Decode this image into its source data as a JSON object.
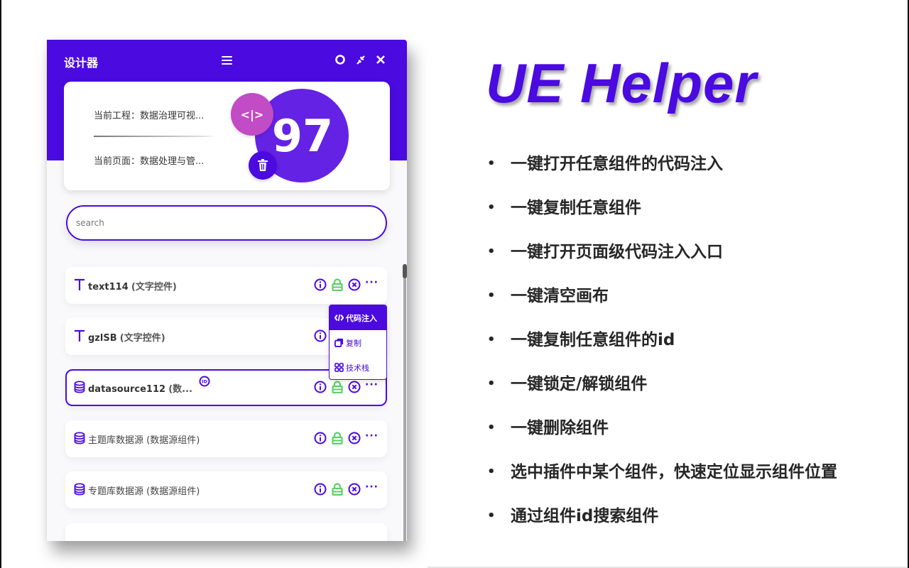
{
  "panel": {
    "title": "设计器",
    "header_icons": [
      "menu-icon",
      "refresh-icon",
      "collapse-icon",
      "close-icon"
    ],
    "project_line": "当前工程：数据治理可视...",
    "page_line": "当前页面：数据处理与管...",
    "component_count": "97",
    "code_button_glyph": "<|>",
    "search": {
      "placeholder": "search",
      "value": ""
    },
    "popover": {
      "items": [
        {
          "label": "代码注入",
          "icon": "code-icon"
        },
        {
          "label": "复制",
          "icon": "copy-icon"
        },
        {
          "label": "技术栈",
          "icon": "grid-icon"
        }
      ]
    },
    "components": [
      {
        "name": "text114",
        "type": "(文字控件)",
        "icon": "text-icon"
      },
      {
        "name": "gzlSB",
        "type": "(文字控件)",
        "icon": "text-icon"
      },
      {
        "name": "datasource112",
        "type": "(数...",
        "icon": "database-icon",
        "selected": true
      },
      {
        "name": "主题库数据源",
        "type": "(数据源组件)",
        "icon": "database-icon"
      },
      {
        "name": "专题库数据源",
        "type": "(数据源组件)",
        "icon": "database-icon"
      }
    ],
    "more_glyph": "···"
  },
  "brand": {
    "title": "UE Helper"
  },
  "features": [
    "一键打开任意组件的代码注入",
    "一键复制任意组件",
    "一键打开页面级代码注入入口",
    "一键清空画布",
    "一键复制任意组件的id",
    "一键锁定/解锁组件",
    "一键删除组件",
    "选中插件中某个组件，快速定位显示组件位置",
    "通过组件id搜索组件"
  ],
  "bullet": "•",
  "colors": {
    "brand": "#4a0ae0",
    "circle": "#6422e4",
    "code_fab": "#c24bc6",
    "lock": "#5ccf6a"
  }
}
